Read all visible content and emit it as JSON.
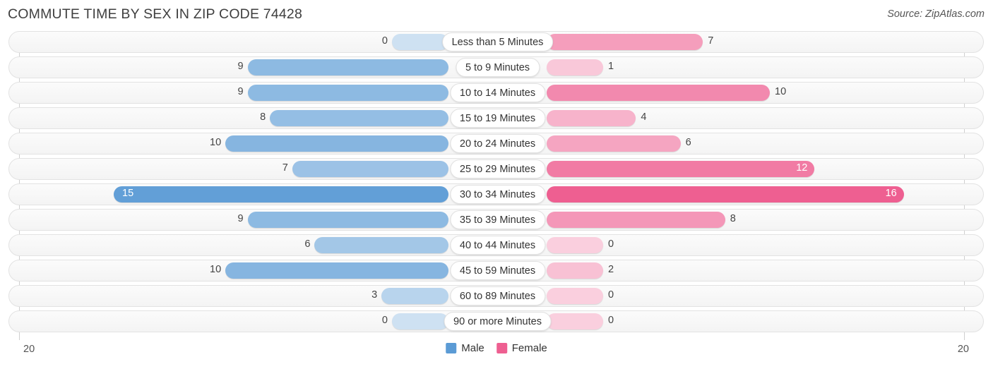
{
  "header": {
    "title": "COMMUTE TIME BY SEX IN ZIP CODE 74428",
    "source": "Source: ZipAtlas.com"
  },
  "legend": {
    "items": [
      {
        "label": "Male",
        "color": "#5b9bd5"
      },
      {
        "label": "Female",
        "color": "#ee5f91"
      }
    ]
  },
  "axis": {
    "left_tick": "20",
    "right_tick": "20",
    "max": 20
  },
  "chart_data": {
    "type": "bar",
    "title": "COMMUTE TIME BY SEX IN ZIP CODE 74428",
    "orientation": "horizontal-diverging",
    "xlabel": "",
    "ylabel": "",
    "xlim": [
      20,
      20
    ],
    "grid": false,
    "legend_position": "bottom-center",
    "categories": [
      "Less than 5 Minutes",
      "5 to 9 Minutes",
      "10 to 14 Minutes",
      "15 to 19 Minutes",
      "20 to 24 Minutes",
      "25 to 29 Minutes",
      "30 to 34 Minutes",
      "35 to 39 Minutes",
      "40 to 44 Minutes",
      "45 to 59 Minutes",
      "60 to 89 Minutes",
      "90 or more Minutes"
    ],
    "series": [
      {
        "name": "Male",
        "color": "#5b9bd5",
        "values": [
          0,
          9,
          9,
          8,
          10,
          7,
          15,
          9,
          6,
          10,
          3,
          0
        ]
      },
      {
        "name": "Female",
        "color": "#ee5f91",
        "values": [
          7,
          1,
          10,
          4,
          6,
          12,
          16,
          8,
          0,
          2,
          0,
          0
        ]
      }
    ]
  }
}
